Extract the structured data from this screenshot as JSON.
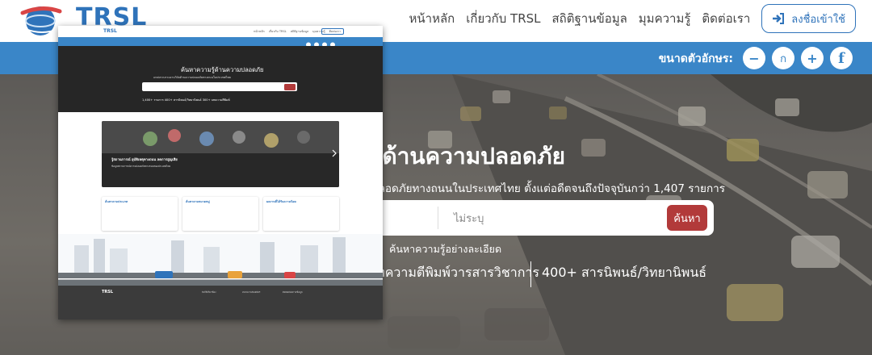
{
  "brand": {
    "logo_text": "TRSL"
  },
  "nav": {
    "items": [
      "หน้าหลัก",
      "เกี่ยวกับ TRSL",
      "สถิติฐานข้อมูล",
      "มุมความรู้",
      "ติดต่อเรา"
    ],
    "login_label": "ลงชื่อเข้าใช้"
  },
  "font_size_bar": {
    "label": "ขนาดตัวอักษร:",
    "decrease": "−",
    "normal": "ก",
    "increase": "+",
    "facebook": "f"
  },
  "hero": {
    "title": "มรู้ด้านความปลอดภัย",
    "subtitle": "ปลอดภัยทางถนนในประเทศไทย ตั้งแต่อดีตจนถึงปัจจุบันกว่า 1,407 รายการ",
    "search_placeholder": "ไม่ระบุ",
    "search_button": "ค้นหา",
    "advanced_link": "ค้นหาความรู้อย่างละเอียด",
    "stat_1": "บทความตีพิมพ์วารสารวิชาการ",
    "stat_2": "400+ สารนิพนธ์/วิทยานิพนธ์"
  },
  "thumbnail": {
    "logo": "TRSL",
    "nav": [
      "หน้าหลัก",
      "เกี่ยวกับ TRSL",
      "สถิติฐานข้อมูล",
      "มุมความรู้",
      "ติดต่อเรา"
    ],
    "hero_title": "ค้นหาความรู้ด้านความปลอดภัย",
    "hero_sub": "แหล่งรวบรวมงานวิจัยด้านความปลอดภัยทางถนนในประเทศไทย",
    "search_btn": "ค้นหา",
    "stats": "1,400+ รายการ   400+ สารนิพนธ์/วิทยานิพนธ์   300+ บทความตีพิมพ์",
    "banner_title": "รู้สถานการณ์ อุบัติเหตุทางถนน ลดการสูญเสีย",
    "banner_text": "ข้อมูลสถานการณ์ความปลอดภัยทางถนนของประเทศไทย",
    "cards": [
      "ค้นหาตามประเภท",
      "ค้นหาตามหมวดหมู่",
      "ผลงานที่ได้รับความนิยม"
    ],
    "footer_logo": "TRSL",
    "footer_cols": [
      "ลิงก์ที่เกี่ยวข้อง",
      "หน่วยงานพันธมิตร",
      "ติดต่อสอบถามข้อมูล"
    ]
  }
}
